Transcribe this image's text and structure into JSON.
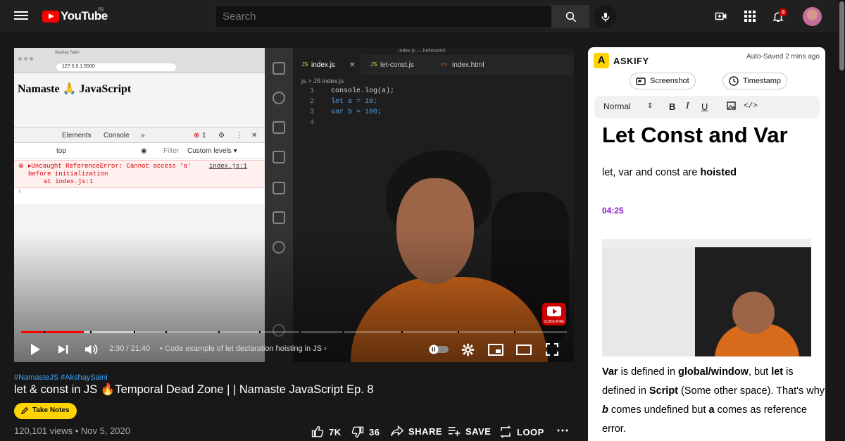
{
  "header": {
    "logo_text": "YouTube",
    "region": "IN",
    "search_placeholder": "Search",
    "notification_count": "8"
  },
  "player": {
    "browser_url": "127.0.0.1:5500",
    "browser_tab": "Akshay Saini",
    "webpage_heading": "Namaste 🙏 JavaScript",
    "devtools_tabs": [
      "Elements",
      "Console",
      "»"
    ],
    "error_count": "1",
    "console_context": "top",
    "filter_label": "Filter",
    "levels_label": "Custom levels ▾",
    "error_line1": "▸Uncaught ReferenceError: Cannot access 'a'",
    "error_line2": "before initialization",
    "error_line3": "at index.js:1",
    "error_source": "index.js:1",
    "editor_window_title": "index.js — helloworld",
    "editor_tabs": [
      "index.js",
      "let-const.js",
      "index.html"
    ],
    "breadcrumb": "js > JS index.js",
    "code_lines": [
      "console.log(a);",
      "let a = 10;",
      "var b = 100;",
      ""
    ],
    "line_numbers": [
      "1",
      "2",
      "3",
      "4"
    ],
    "subscribe_label": "SUBSCRIBE",
    "current_time": "2:30",
    "duration": "21:40",
    "progress": 0.115,
    "buffered": 0.21,
    "chapter_title": "Code example of let declaration hoisting in JS"
  },
  "video": {
    "hashtags": "#NamasteJS #AkshaySaini",
    "title": "let & const in JS 🔥Temporal Dead Zone | | Namaste JavaScript Ep. 8",
    "take_notes": "Take Notes",
    "views": "120,101 views • Nov 5, 2020",
    "likes": "7K",
    "dislikes": "36",
    "share": "SHARE",
    "save": "SAVE",
    "loop": "LOOP"
  },
  "askify": {
    "brand": "ASKIFY",
    "autosaved": "Auto-Saved 2 mins ago",
    "screenshot_btn": "Screenshot",
    "timestamp_btn": "Timestamp",
    "format": "Normal",
    "note_title": "Let Const and Var",
    "line1_pre": "let, var and const are ",
    "line1_bold": "hoisted",
    "timestamp": "04:25",
    "p2_a": "Var",
    "p2_b": " is defined in ",
    "p2_c": "global/window",
    "p2_d": ", but ",
    "p2_e": "let",
    "p2_f": " is",
    "p3_a": "defined in ",
    "p3_b": "Script",
    "p3_c": " (Some other space). That's why",
    "p4_a": "b",
    "p4_b": " comes undefined but ",
    "p4_c": "a",
    "p4_d": " comes as reference",
    "p5": "error."
  },
  "colors": {
    "accent_red": "#ff0000",
    "askify_yellow": "#ffd400",
    "timestamp_purple": "#8a1ec9",
    "link_blue": "#3ea6ff"
  }
}
